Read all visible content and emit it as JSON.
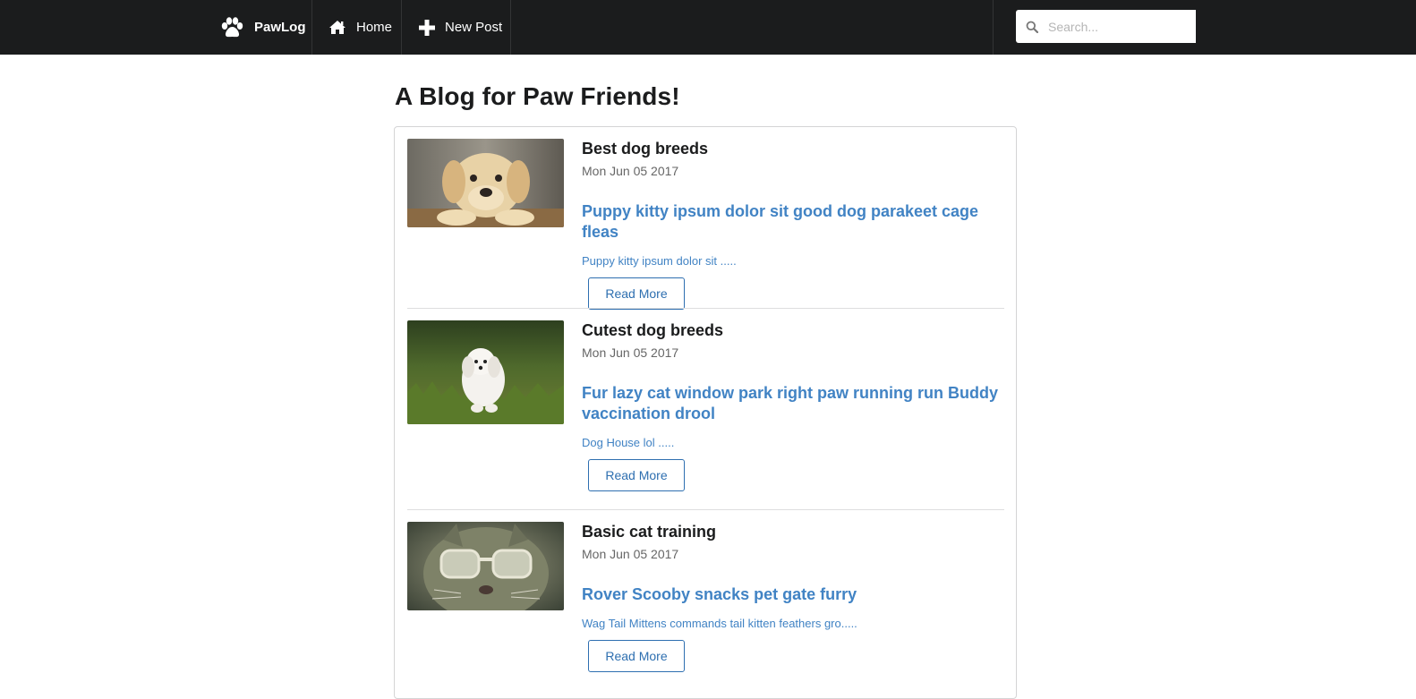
{
  "nav": {
    "brand": "PawLog",
    "home": "Home",
    "new_post": "New Post",
    "search_placeholder": "Search..."
  },
  "page": {
    "title": "A Blog for Paw Friends!"
  },
  "posts": [
    {
      "title": "Best dog breeds",
      "date": "Mon Jun 05 2017",
      "headline": "Puppy kitty ipsum dolor sit good dog parakeet cage fleas",
      "snippet": "Puppy kitty ipsum dolor sit .....",
      "button": "Read More",
      "image": "labrador-puppy-photo"
    },
    {
      "title": "Cutest dog breeds",
      "date": "Mon Jun 05 2017",
      "headline": "Fur lazy cat window park right paw running run Buddy vaccination drool",
      "snippet": "Dog House lol .....",
      "button": "Read More",
      "image": "white-puppy-on-grass-photo"
    },
    {
      "title": "Basic cat training",
      "date": "Mon Jun 05 2017",
      "headline": "Rover Scooby snacks pet gate furry",
      "snippet": "Wag Tail Mittens commands tail kitten feathers gro.....",
      "button": "Read More",
      "image": "cat-with-glasses-photo"
    }
  ],
  "colors": {
    "navbar": "#1b1c1d",
    "link": "#4183c4",
    "button_border": "#2e6fb0"
  }
}
